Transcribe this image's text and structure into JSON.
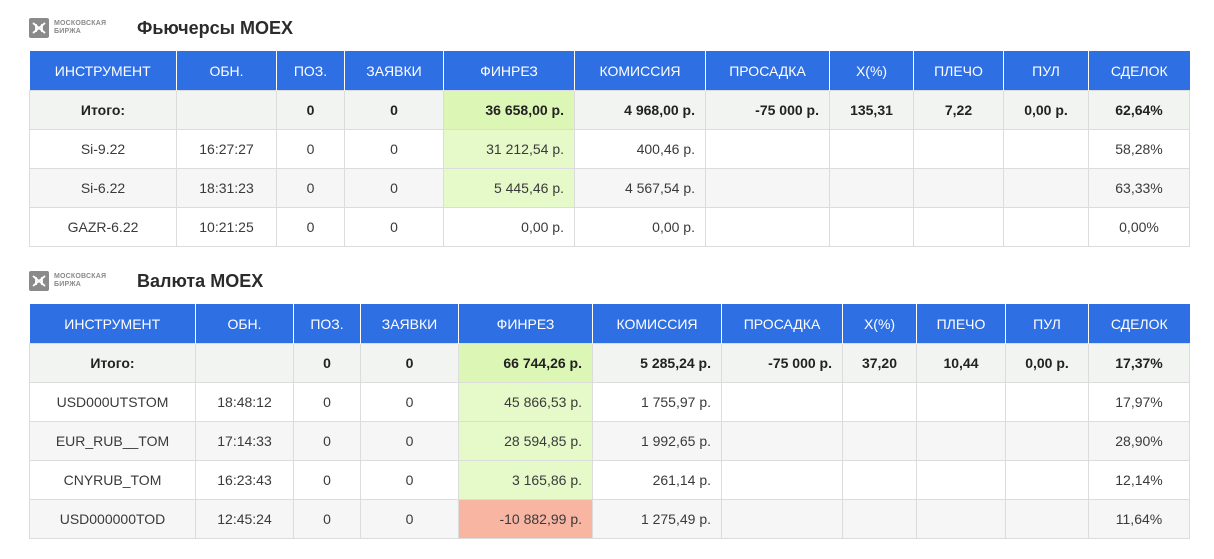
{
  "futures": {
    "logo_line1": "МОСКОВСКАЯ",
    "logo_line2": "БИРЖА",
    "title": "Фьючерсы MOEX",
    "headers": [
      "ИНСТРУМЕНТ",
      "ОБН.",
      "ПОЗ.",
      "ЗАЯВКИ",
      "ФИНРЕЗ",
      "КОМИССИЯ",
      "ПРОСАДКА",
      "X(%)",
      "ПЛЕЧО",
      "ПУЛ",
      "СДЕЛОК"
    ],
    "total": {
      "instrument": "Итого:",
      "updated": "",
      "pos": "0",
      "orders": "0",
      "finres": "36 658,00 р.",
      "commission": "4 968,00 р.",
      "drawdown": "-75 000 р.",
      "x_pct": "135,31",
      "leverage": "7,22",
      "pool": "0,00 р.",
      "deals": "62,64%"
    },
    "rows": [
      {
        "instrument": "Si-9.22",
        "updated": "16:27:27",
        "pos": "0",
        "orders": "0",
        "finres": "31 212,54 р.",
        "commission": "400,46 р.",
        "drawdown": "",
        "x_pct": "",
        "leverage": "",
        "pool": "",
        "deals": "58,28%"
      },
      {
        "instrument": "Si-6.22",
        "updated": "18:31:23",
        "pos": "0",
        "orders": "0",
        "finres": "5 445,46 р.",
        "commission": "4 567,54 р.",
        "drawdown": "",
        "x_pct": "",
        "leverage": "",
        "pool": "",
        "deals": "63,33%"
      },
      {
        "instrument": "GAZR-6.22",
        "updated": "10:21:25",
        "pos": "0",
        "orders": "0",
        "finres": "0,00 р.",
        "commission": "0,00 р.",
        "drawdown": "",
        "x_pct": "",
        "leverage": "",
        "pool": "",
        "deals": "0,00%"
      }
    ]
  },
  "currency": {
    "logo_line1": "МОСКОВСКАЯ",
    "logo_line2": "БИРЖА",
    "title": "Валюта MOEX",
    "headers": [
      "ИНСТРУМЕНТ",
      "ОБН.",
      "ПОЗ.",
      "ЗАЯВКИ",
      "ФИНРЕЗ",
      "КОМИССИЯ",
      "ПРОСАДКА",
      "X(%)",
      "ПЛЕЧО",
      "ПУЛ",
      "СДЕЛОК"
    ],
    "total": {
      "instrument": "Итого:",
      "updated": "",
      "pos": "0",
      "orders": "0",
      "finres": "66 744,26 р.",
      "commission": "5 285,24 р.",
      "drawdown": "-75 000 р.",
      "x_pct": "37,20",
      "leverage": "10,44",
      "pool": "0,00 р.",
      "deals": "17,37%"
    },
    "rows": [
      {
        "instrument": "USD000UTSTOM",
        "updated": "18:48:12",
        "pos": "0",
        "orders": "0",
        "finres": "45 866,53 р.",
        "commission": "1 755,97 р.",
        "drawdown": "",
        "x_pct": "",
        "leverage": "",
        "pool": "",
        "deals": "17,97%"
      },
      {
        "instrument": "EUR_RUB__TOM",
        "updated": "17:14:33",
        "pos": "0",
        "orders": "0",
        "finres": "28 594,85 р.",
        "commission": "1 992,65 р.",
        "drawdown": "",
        "x_pct": "",
        "leverage": "",
        "pool": "",
        "deals": "28,90%"
      },
      {
        "instrument": "CNYRUB_TOM",
        "updated": "16:23:43",
        "pos": "0",
        "orders": "0",
        "finres": "3 165,86 р.",
        "commission": "261,14 р.",
        "drawdown": "",
        "x_pct": "",
        "leverage": "",
        "pool": "",
        "deals": "12,14%"
      },
      {
        "instrument": "USD000000TOD",
        "updated": "12:45:24",
        "pos": "0",
        "orders": "0",
        "finres": "-10 882,99 р.",
        "commission": "1 275,49 р.",
        "drawdown": "",
        "x_pct": "",
        "leverage": "",
        "pool": "",
        "deals": "11,64%"
      }
    ]
  },
  "colors": {
    "header_blue": "#2f6fe4",
    "profit_green": "#e6fac9",
    "loss_red": "#f8b6a2",
    "logo_gray": "#8a8a8a"
  },
  "icons": {
    "logo": "moex-logo-icon"
  }
}
